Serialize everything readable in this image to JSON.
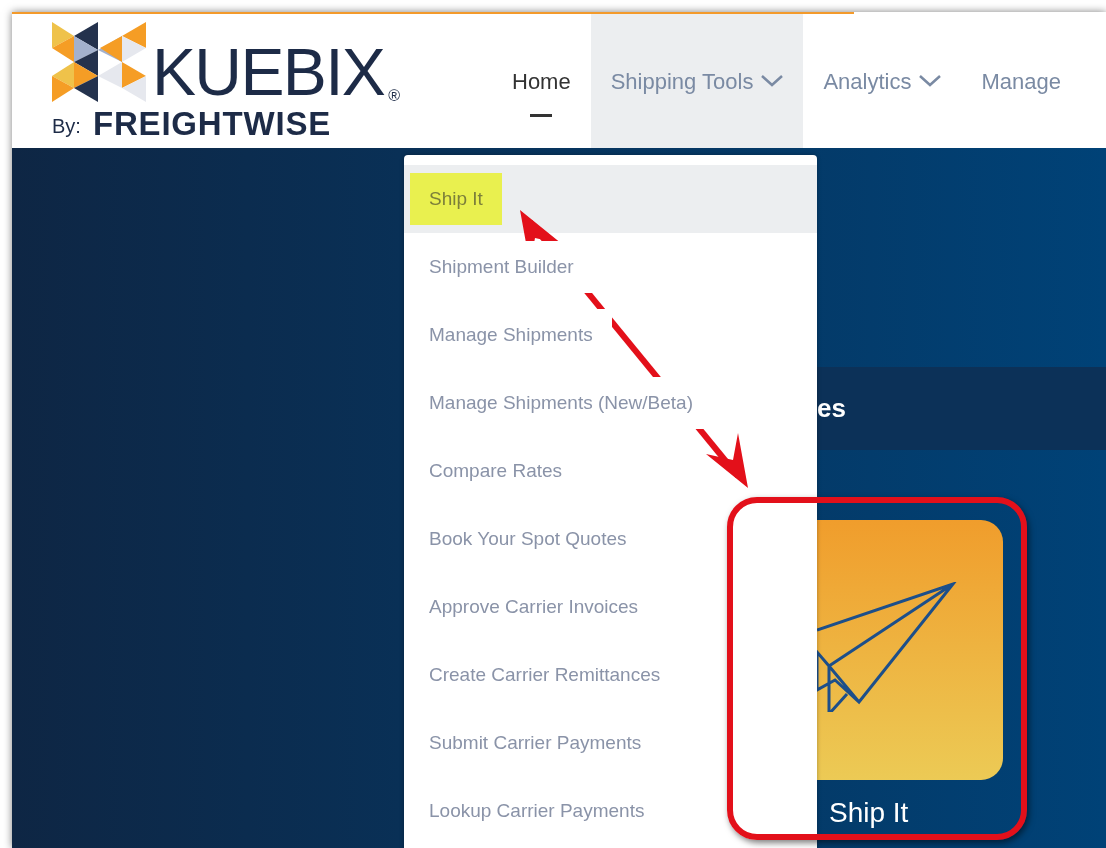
{
  "load_progress": {
    "level": 0.77
  },
  "logo": {
    "name": "KUEBIX",
    "mark": "®",
    "by": "By:",
    "company": "FREIGHTWISE"
  },
  "nav": [
    {
      "label": "Home",
      "selected": true,
      "dropdown": false
    },
    {
      "label": "Shipping Tools",
      "selected": false,
      "dropdown": true,
      "expanded": true
    },
    {
      "label": "Analytics",
      "selected": false,
      "dropdown": true,
      "expanded": false
    },
    {
      "label": "Manage",
      "selected": false,
      "dropdown": false
    }
  ],
  "menu": [
    {
      "label": "Ship It",
      "selected": true,
      "highlighted": true
    },
    {
      "label": "Shipment Builder",
      "selected": false,
      "highlighted": false
    },
    {
      "label": "Manage Shipments",
      "selected": false,
      "highlighted": false
    },
    {
      "label": "Manage Shipments (New/Beta)",
      "selected": false,
      "highlighted": false
    },
    {
      "label": "Compare Rates",
      "selected": false,
      "highlighted": false
    },
    {
      "label": "Book Your Spot Quotes",
      "selected": false,
      "highlighted": false
    },
    {
      "label": "Approve Carrier Invoices",
      "selected": false,
      "highlighted": false
    },
    {
      "label": "Create Carrier Remittances",
      "selected": false,
      "highlighted": false
    },
    {
      "label": "Submit Carrier Payments",
      "selected": false,
      "highlighted": false
    },
    {
      "label": "Lookup Carrier Payments",
      "selected": false,
      "highlighted": false
    }
  ],
  "section_heading": "es",
  "tile": {
    "label": "Ship It"
  }
}
